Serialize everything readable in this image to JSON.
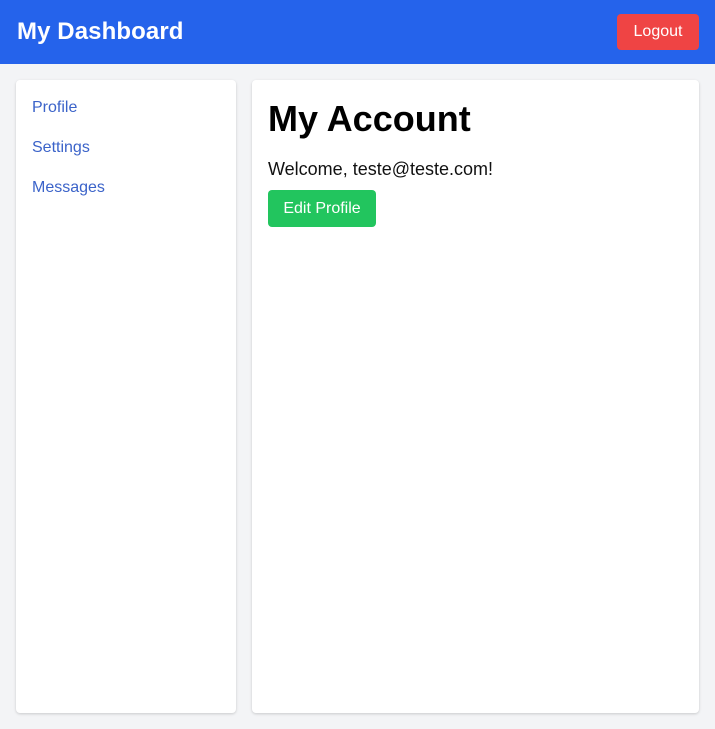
{
  "header": {
    "title": "My Dashboard",
    "logout_label": "Logout"
  },
  "sidebar": {
    "items": [
      {
        "label": "Profile"
      },
      {
        "label": "Settings"
      },
      {
        "label": "Messages"
      }
    ]
  },
  "main": {
    "title": "My Account",
    "welcome": "Welcome, teste@teste.com!",
    "edit_label": "Edit Profile"
  },
  "colors": {
    "header_bg": "#2563eb",
    "logout_bg": "#ef4444",
    "edit_bg": "#22c55e",
    "nav_link": "#3b63c9",
    "page_bg": "#f3f4f6"
  }
}
